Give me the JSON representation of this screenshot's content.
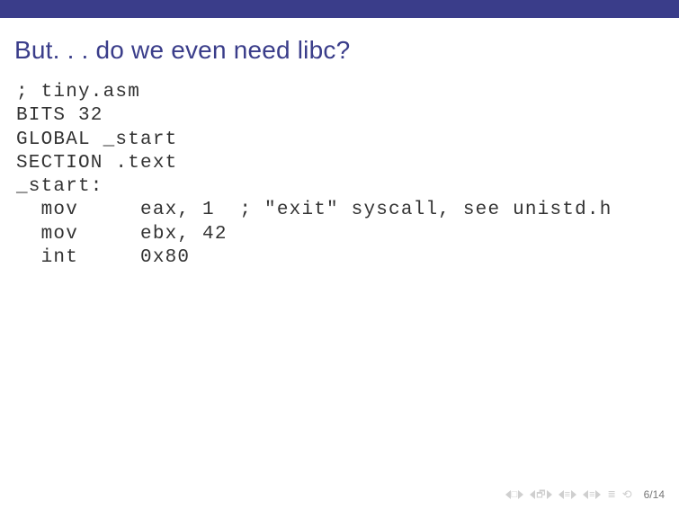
{
  "slide": {
    "title": "But. . . do we even need libc?",
    "code": "; tiny.asm\nBITS 32\nGLOBAL _start\nSECTION .text\n_start:\n  mov     eax, 1  ; \"exit\" syscall, see unistd.h\n  mov     ebx, 42\n  int     0x80",
    "page_current": "6",
    "page_sep": "/",
    "page_total": "14"
  },
  "nav": {
    "square": "□",
    "doc": "🗗",
    "bar1": "≡",
    "bar2": "≡",
    "marker": "≣",
    "undo": "⟲"
  }
}
